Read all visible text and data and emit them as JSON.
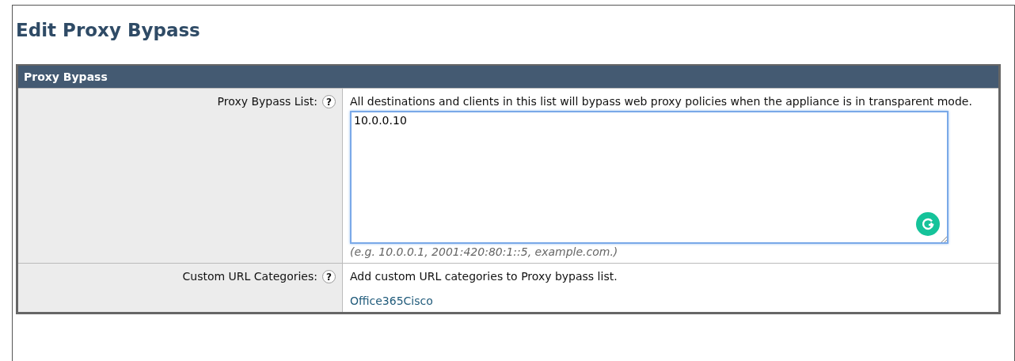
{
  "page_title": "Edit Proxy Bypass",
  "section": {
    "title": "Proxy Bypass",
    "rows": [
      {
        "kind": "textarea",
        "label": "Proxy Bypass List:",
        "help": "?",
        "description": "All destinations and clients in this list will bypass web proxy policies when the appliance is in transparent mode.",
        "value": "10.0.0.10",
        "focused": true,
        "hint": "(e.g. 10.0.0.1, 2001:420:80:1::5, example.com.)"
      },
      {
        "kind": "links",
        "label": "Custom URL Categories:",
        "help": "?",
        "description": "Add custom URL categories to Proxy bypass list.",
        "links": [
          "Office365Cisco"
        ]
      }
    ]
  }
}
